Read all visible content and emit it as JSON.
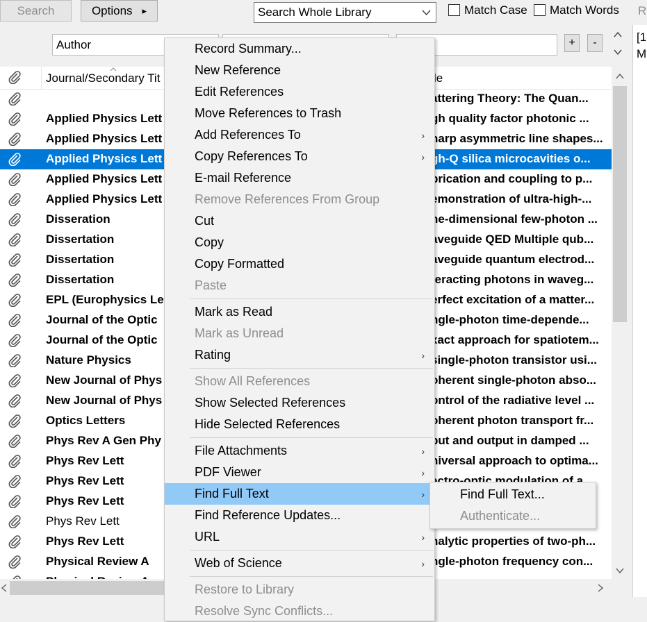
{
  "toolbar": {
    "search_label": "Search",
    "options_label": "Options",
    "options_arrow": "▸",
    "scope_value": "Search Whole Library",
    "match_case_label": "Match Case",
    "match_words_label": "Match Words",
    "right_clip": "Re"
  },
  "search_row": {
    "field_value": "Author",
    "plus_label": "+",
    "minus_label": "-"
  },
  "list": {
    "col_journal": "Journal/Secondary Tit",
    "col_title": "le",
    "rows": [
      {
        "journal": "",
        "title": "attering Theory: The Quan..."
      },
      {
        "journal": "Applied Physics Lett",
        "title": "gh quality factor photonic ..."
      },
      {
        "journal": "Applied Physics Lett",
        "title": "harp asymmetric line shapes..."
      },
      {
        "journal": "Applied Physics Lett",
        "title": "gh-Q silica microcavities o..."
      },
      {
        "journal": "Applied Physics Lett",
        "title": "brication and coupling to p..."
      },
      {
        "journal": "Applied Physics Lett",
        "title": "emonstration of ultra-high-..."
      },
      {
        "journal": "Disseration",
        "title": "ne-dimensional few-photon ..."
      },
      {
        "journal": "Dissertation",
        "title": "aveguide QED Multiple qub..."
      },
      {
        "journal": "Dissertation",
        "title": "aveguide quantum electrod..."
      },
      {
        "journal": "Dissertation",
        "title": "teracting photons in waveg..."
      },
      {
        "journal": "EPL (Europhysics Let",
        "title": "erfect excitation of a matter..."
      },
      {
        "journal": "Journal of the Optic",
        "title": "ngle-photon time-depende..."
      },
      {
        "journal": "Journal of the Optic",
        "title": "xact approach for spatiotem..."
      },
      {
        "journal": "Nature Physics",
        "title": "single-photon transistor usi..."
      },
      {
        "journal": "New Journal of Phys",
        "title": "oherent single-photon abso..."
      },
      {
        "journal": "New Journal of Phys",
        "title": "ontrol of the radiative level ..."
      },
      {
        "journal": "Optics Letters",
        "title": "oherent photon transport fr..."
      },
      {
        "journal": "Phys Rev A Gen Phy",
        "title": "put and output in damped ..."
      },
      {
        "journal": "Phys Rev Lett",
        "title": "niversal approach to optima..."
      },
      {
        "journal": "Phys Rev Lett",
        "title": "ectro-optic modulation of a..."
      },
      {
        "journal": "Phys Rev Lett",
        "title": ""
      },
      {
        "journal": "Phys Rev Lett",
        "title": ""
      },
      {
        "journal": "Phys Rev Lett",
        "title": "nalytic properties of two-ph..."
      },
      {
        "journal": "Physical Review A",
        "title": "ngle-photon frequency con..."
      },
      {
        "journal": "Physical Review A",
        "title": ""
      }
    ]
  },
  "preview": {
    "line1": "[1",
    "line2": "M"
  },
  "context_menu": {
    "items": [
      {
        "label": "Record Summary...",
        "enabled": true,
        "submenu": false
      },
      {
        "label": "New Reference",
        "enabled": true,
        "submenu": false
      },
      {
        "label": "Edit References",
        "enabled": true,
        "submenu": false
      },
      {
        "label": "Move References to Trash",
        "enabled": true,
        "submenu": false
      },
      {
        "label": "Add References To",
        "enabled": true,
        "submenu": true
      },
      {
        "label": "Copy References To",
        "enabled": true,
        "submenu": true
      },
      {
        "label": "E-mail Reference",
        "enabled": true,
        "submenu": false
      },
      {
        "label": "Remove References From Group",
        "enabled": false,
        "submenu": false
      },
      {
        "label": "Cut",
        "enabled": true,
        "submenu": false
      },
      {
        "label": "Copy",
        "enabled": true,
        "submenu": false
      },
      {
        "label": "Copy Formatted",
        "enabled": true,
        "submenu": false
      },
      {
        "label": "Paste",
        "enabled": false,
        "submenu": false
      },
      {
        "label": "Mark as Read",
        "enabled": true,
        "submenu": false
      },
      {
        "label": "Mark as Unread",
        "enabled": false,
        "submenu": false
      },
      {
        "label": "Rating",
        "enabled": true,
        "submenu": true
      },
      {
        "label": "Show All References",
        "enabled": false,
        "submenu": false
      },
      {
        "label": "Show Selected References",
        "enabled": true,
        "submenu": false
      },
      {
        "label": "Hide Selected References",
        "enabled": true,
        "submenu": false
      },
      {
        "label": "File Attachments",
        "enabled": true,
        "submenu": true
      },
      {
        "label": "PDF Viewer",
        "enabled": true,
        "submenu": true
      },
      {
        "label": "Find Full Text",
        "enabled": true,
        "submenu": true
      },
      {
        "label": "Find Reference Updates...",
        "enabled": true,
        "submenu": false
      },
      {
        "label": "URL",
        "enabled": true,
        "submenu": true
      },
      {
        "label": "Web of Science",
        "enabled": true,
        "submenu": true
      },
      {
        "label": "Restore to Library",
        "enabled": false,
        "submenu": false
      },
      {
        "label": "Resolve Sync Conflicts...",
        "enabled": false,
        "submenu": false
      }
    ],
    "submenu_arrow": "›"
  },
  "find_full_text_submenu": {
    "items": [
      {
        "label": "Find Full Text...",
        "enabled": true
      },
      {
        "label": "Authenticate...",
        "enabled": false
      }
    ]
  },
  "colors": {
    "selection": "#0078d7",
    "menu_hover": "#91c9f7",
    "menu_bg": "#f2f2f2"
  }
}
